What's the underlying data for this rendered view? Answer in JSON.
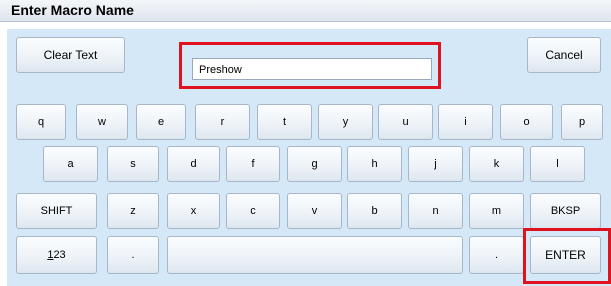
{
  "title": "Enter Macro Name",
  "top": {
    "clear_label": "Clear Text",
    "name_value": "Preshow",
    "cancel_label": "Cancel"
  },
  "row1": [
    "q",
    "w",
    "e",
    "r",
    "t",
    "y",
    "u",
    "i",
    "o",
    "p"
  ],
  "row2": [
    "a",
    "s",
    "d",
    "f",
    "g",
    "h",
    "j",
    "k",
    "l"
  ],
  "row3": [
    "SHIFT",
    "z",
    "x",
    "c",
    "v",
    "b",
    "n",
    "m",
    "BKSP"
  ],
  "row4": {
    "mode_label_hotkey": "1",
    "mode_label_rest": "23",
    "period_left": ".",
    "period_right": ".",
    "enter_label": "ENTER"
  },
  "colors": {
    "highlight": "#e0121f",
    "panel": "#d5e8f7"
  }
}
